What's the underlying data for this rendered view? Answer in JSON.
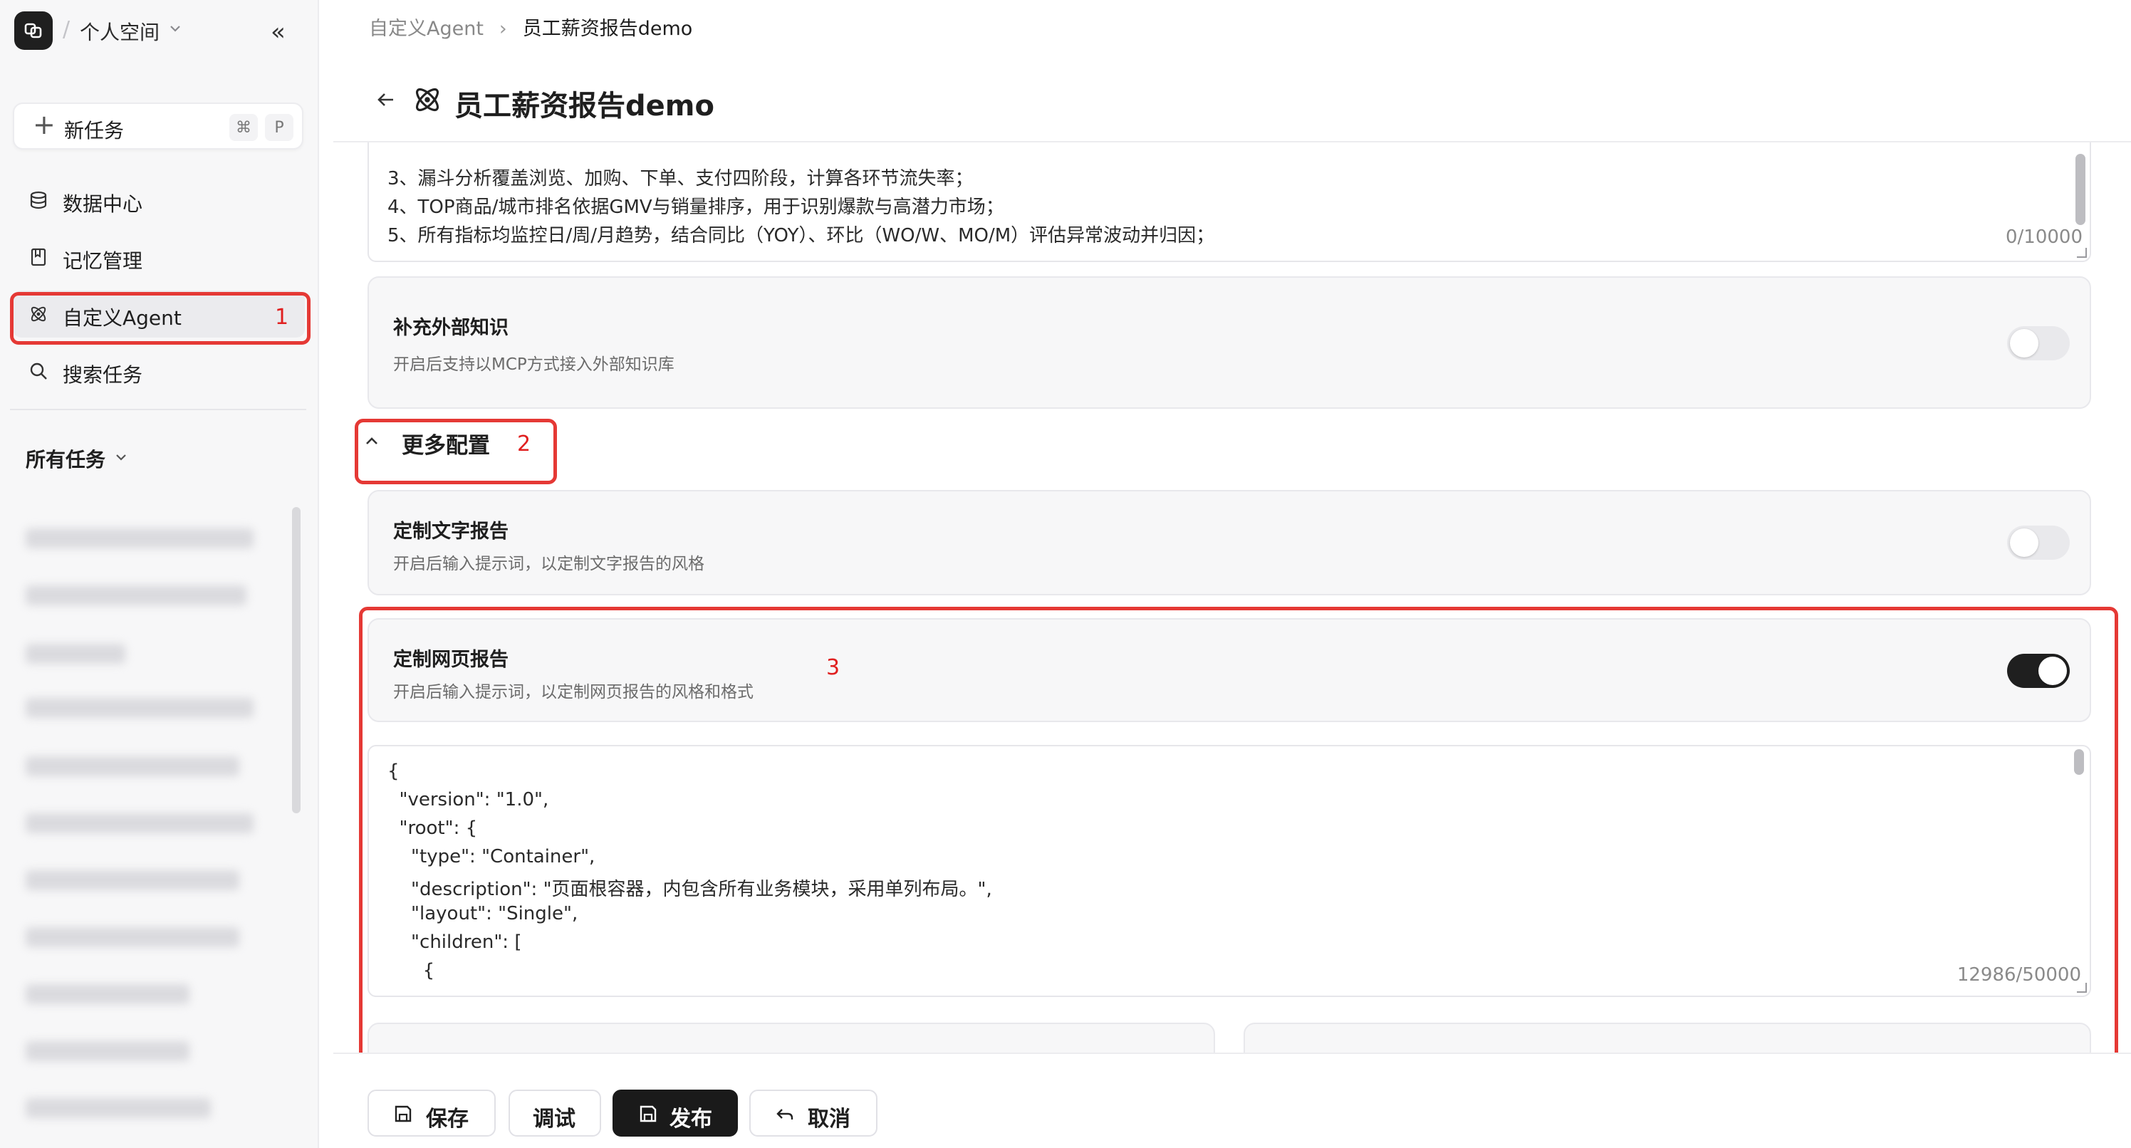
{
  "sidebar": {
    "workspace_name": "个人空间",
    "new_task_label": "新任务",
    "new_task_shortcut": [
      "⌘",
      "P"
    ],
    "nav": [
      {
        "label": "数据中心",
        "icon": "database-icon"
      },
      {
        "label": "记忆管理",
        "icon": "book-icon"
      },
      {
        "label": "自定义Agent",
        "icon": "atom-icon",
        "active": true
      },
      {
        "label": "搜索任务",
        "icon": "search-icon"
      }
    ],
    "all_tasks_label": "所有任务"
  },
  "breadcrumb": {
    "parent": "自定义Agent",
    "current": "员工薪资报告demo"
  },
  "page_title": "员工薪资报告demo",
  "rules_textarea": {
    "lines": [
      "3、漏斗分析覆盖浏览、加购、下单、支付四阶段，计算各环节流失率；",
      "4、TOP商品/城市排名依据GMV与销量排序，用于识别爆款与高潜力市场；",
      "5、所有指标均监控日/周/月趋势，结合同比（YOY）、环比（WO/W、MO/M）评估异常波动并归因；"
    ],
    "counter": "0/10000"
  },
  "external_knowledge": {
    "title": "补充外部知识",
    "desc": "开启后支持以MCP方式接入外部知识库",
    "enabled": false
  },
  "more_config": {
    "label": "更多配置",
    "expanded": true
  },
  "text_report": {
    "title": "定制文字报告",
    "desc": "开启后输入提示词，以定制文字报告的风格",
    "enabled": false
  },
  "web_report": {
    "title": "定制网页报告",
    "desc": "开启后输入提示词，以定制网页报告的风格和格式",
    "enabled": true,
    "code_lines": [
      "{",
      "  \"version\": \"1.0\",",
      "  \"root\": {",
      "    \"type\": \"Container\",",
      "    \"description\": \"页面根容器，内包含所有业务模块，采用单列布局。\",",
      "    \"layout\": \"Single\",",
      "    \"children\": [",
      "      {"
    ],
    "counter": "12986/50000"
  },
  "annotations": [
    "1",
    "2",
    "3"
  ],
  "footer": {
    "save": "保存",
    "debug": "调试",
    "publish": "发布",
    "cancel": "取消"
  },
  "colors": {
    "highlight_red": "#e53935",
    "primary": "#1a1a1a"
  }
}
